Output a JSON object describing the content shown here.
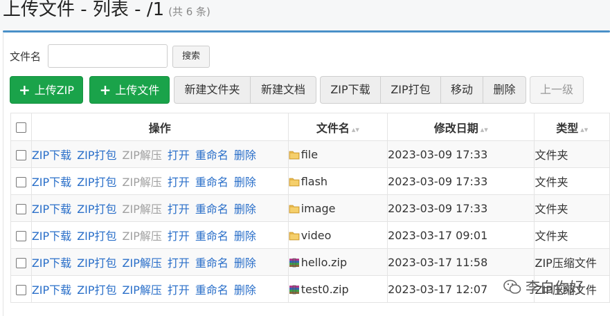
{
  "page": {
    "title": "上传文件 - 列表 - /1",
    "count": "(共 6 条)"
  },
  "filter": {
    "label": "文件名",
    "value": "",
    "search_button": "搜索"
  },
  "toolbar": {
    "upload_zip": "上传ZIP",
    "upload_file": "上传文件",
    "new_folder": "新建文件夹",
    "new_document": "新建文档",
    "zip_download": "ZIP下载",
    "zip_pack": "ZIP打包",
    "move": "移动",
    "delete": "删除",
    "up_level": "上一级"
  },
  "table": {
    "columns": {
      "actions": "操作",
      "filename": "文件名",
      "modified": "修改日期",
      "type": "类型"
    },
    "action_labels": {
      "zip_download": "ZIP下载",
      "zip_pack": "ZIP打包",
      "zip_extract": "ZIP解压",
      "open": "打开",
      "rename": "重命名",
      "delete": "删除"
    },
    "rows": [
      {
        "name": "file",
        "date": "2023-03-09 17:33",
        "type": "文件夹",
        "icon": "folder-icon",
        "can_extract": false
      },
      {
        "name": "flash",
        "date": "2023-03-09 17:33",
        "type": "文件夹",
        "icon": "folder-icon",
        "can_extract": false
      },
      {
        "name": "image",
        "date": "2023-03-09 17:33",
        "type": "文件夹",
        "icon": "folder-icon",
        "can_extract": false
      },
      {
        "name": "video",
        "date": "2023-03-17 09:01",
        "type": "文件夹",
        "icon": "folder-icon",
        "can_extract": false
      },
      {
        "name": "hello.zip",
        "date": "2023-03-17 11:58",
        "type": "ZIP压缩文件",
        "icon": "archive-icon",
        "can_extract": true
      },
      {
        "name": "test0.zip",
        "date": "2023-03-17 12:07",
        "type": "ZIP压缩文件",
        "icon": "archive-icon",
        "can_extract": true
      }
    ]
  },
  "watermark": {
    "text": "李白你好",
    "icon": "wechat-icon"
  },
  "colors": {
    "link": "#2a6fc9",
    "disabled": "#a0a0a0",
    "primary_green": "#1aa34a",
    "divider_blue": "#4a90c8"
  }
}
